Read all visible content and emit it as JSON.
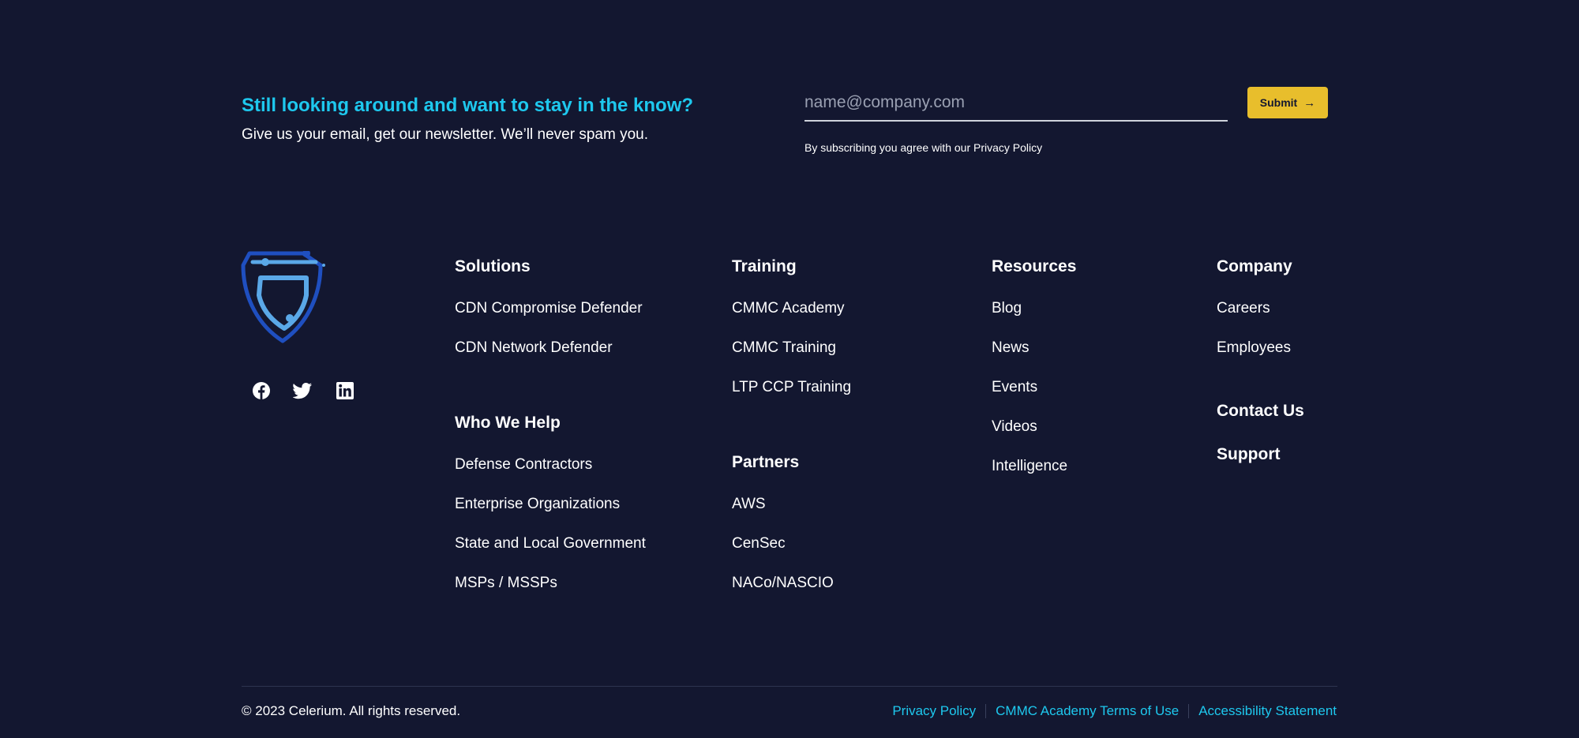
{
  "newsletter": {
    "heading": "Still looking around and want to stay in the know?",
    "subtext": "Give us your email, get our newsletter. We’ll never spam you.",
    "email_placeholder": "name@company.com",
    "submit_label": "Submit",
    "consent": "By subscribing you agree with our Privacy Policy"
  },
  "colors": {
    "background": "#131730",
    "accent": "#1ec8ee",
    "button": "#e8be2c",
    "logo_dark": "#1f4fc0",
    "logo_light": "#5aa8e8"
  },
  "social": [
    "facebook-icon",
    "twitter-icon",
    "linkedin-icon"
  ],
  "columns": {
    "solutions": {
      "heading": "Solutions",
      "links": [
        "CDN Compromise Defender",
        "CDN Network Defender"
      ]
    },
    "who_we_help": {
      "heading": "Who We Help",
      "links": [
        "Defense Contractors",
        "Enterprise Organizations",
        "State and Local Government",
        "MSPs / MSSPs"
      ]
    },
    "training": {
      "heading": "Training",
      "links": [
        "CMMC Academy",
        "CMMC Training",
        "LTP CCP Training"
      ]
    },
    "partners": {
      "heading": "Partners",
      "links": [
        "AWS",
        "CenSec",
        "NACo/NASCIO"
      ]
    },
    "resources": {
      "heading": "Resources",
      "links": [
        "Blog",
        "News",
        "Events",
        "Videos",
        "Intelligence"
      ]
    },
    "company": {
      "heading": "Company",
      "links": [
        "Careers",
        "Employees"
      ]
    },
    "contact": "Contact Us",
    "support": "Support"
  },
  "footer": {
    "copyright": "© 2023 Celerium. All rights reserved.",
    "legal_links": [
      "Privacy Policy",
      "CMMC Academy Terms of Use",
      "Accessibility Statement"
    ]
  }
}
